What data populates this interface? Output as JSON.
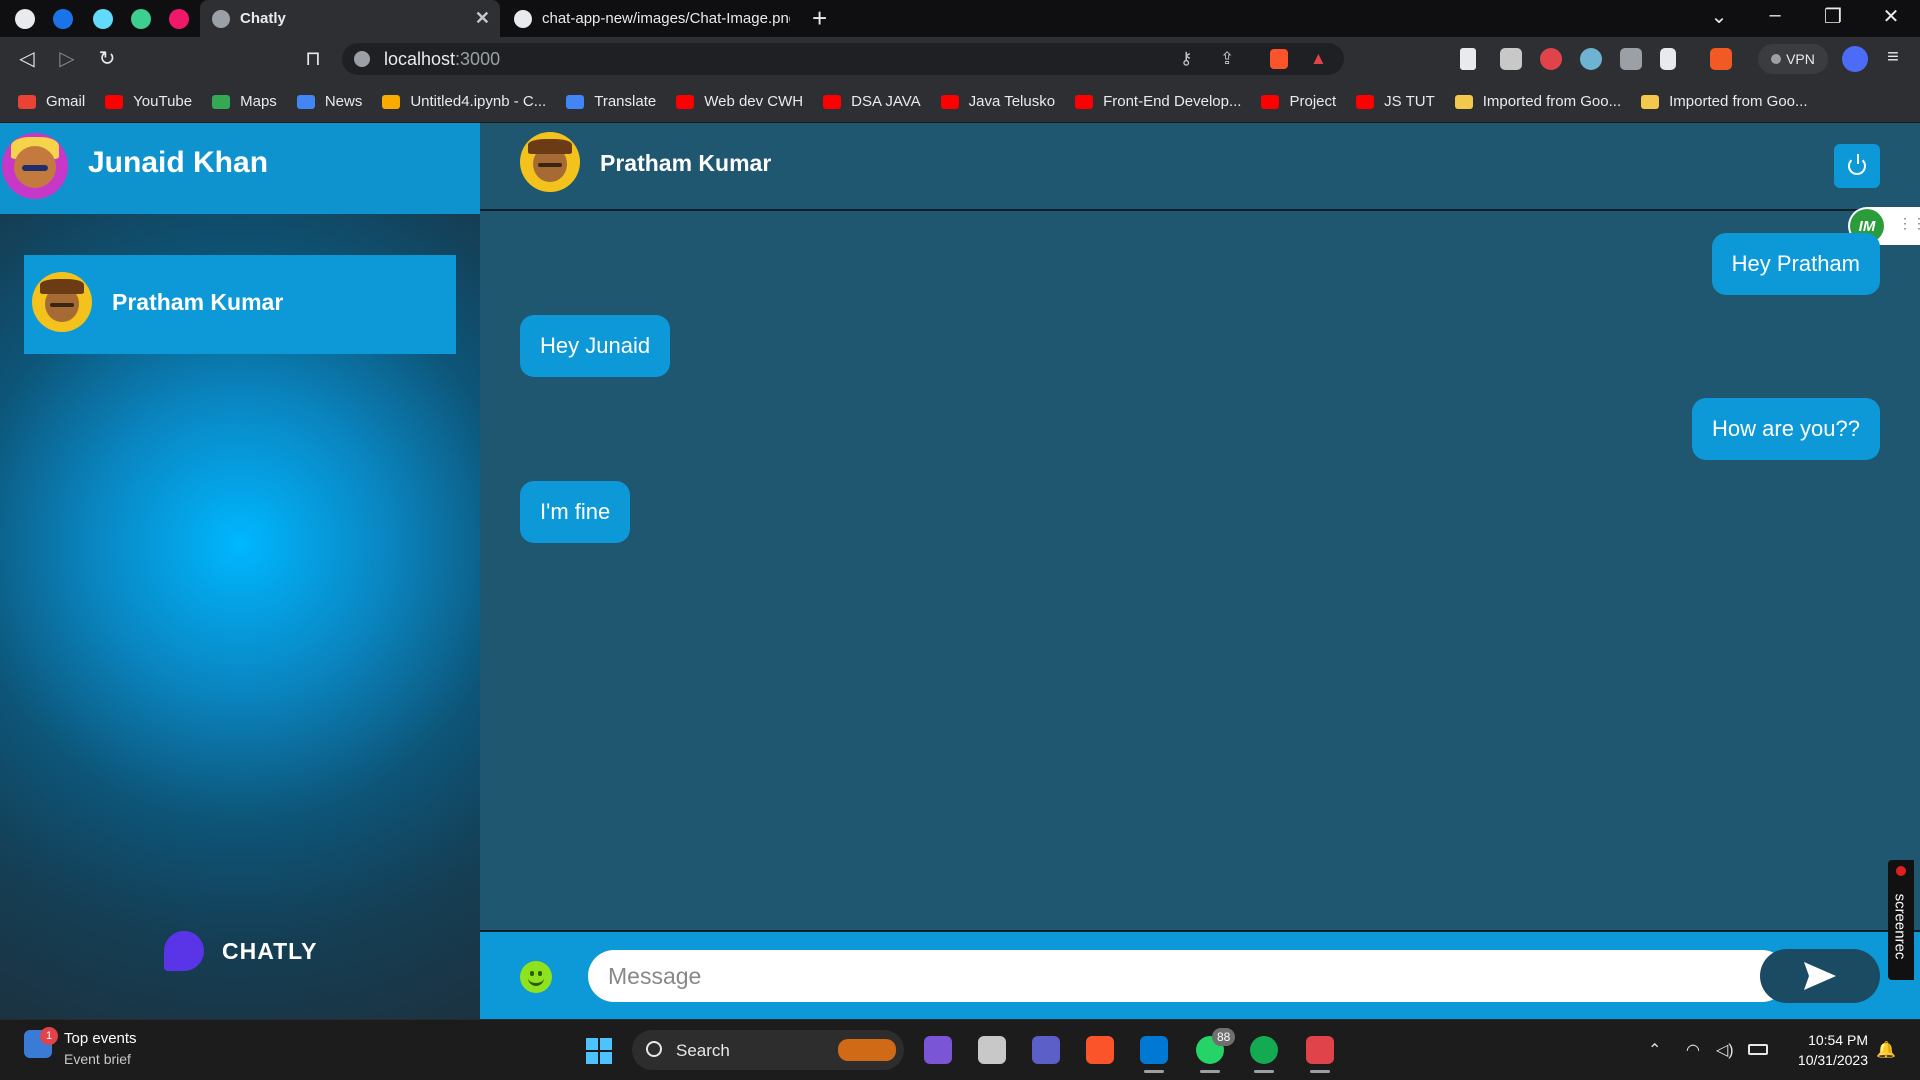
{
  "browser": {
    "tabs": [
      {
        "title": "Chatly",
        "active": true
      },
      {
        "title": "chat-app-new/images/Chat-Image.png",
        "active": false
      }
    ],
    "address": {
      "host": "localhost",
      "port": ":3000"
    },
    "vpn_label": "VPN"
  },
  "bookmarks": [
    {
      "label": "Gmail",
      "icon": "gmail-icon"
    },
    {
      "label": "YouTube",
      "icon": "youtube-icon"
    },
    {
      "label": "Maps",
      "icon": "maps-icon"
    },
    {
      "label": "News",
      "icon": "news-icon"
    },
    {
      "label": "Untitled4.ipynb - C...",
      "icon": "colab-icon"
    },
    {
      "label": "Translate",
      "icon": "translate-icon"
    },
    {
      "label": "Web dev CWH",
      "icon": "youtube-icon"
    },
    {
      "label": "DSA JAVA",
      "icon": "youtube-icon"
    },
    {
      "label": "Java Telusko",
      "icon": "youtube-icon"
    },
    {
      "label": "Front-End Develop...",
      "icon": "youtube-icon"
    },
    {
      "label": "Project",
      "icon": "youtube-icon"
    },
    {
      "label": "JS TUT",
      "icon": "youtube-icon"
    },
    {
      "label": "Imported from Goo...",
      "icon": "folder-icon"
    },
    {
      "label": "Imported from Goo...",
      "icon": "folder-icon"
    }
  ],
  "sidebar": {
    "user_name": "Junaid Khan",
    "contacts": [
      {
        "name": "Pratham Kumar"
      }
    ],
    "brand": "CHATLY"
  },
  "chat": {
    "contact_name": "Pratham Kumar",
    "messages": [
      {
        "text": "Hey Pratham",
        "side": "right"
      },
      {
        "text": "Hey Junaid",
        "side": "left"
      },
      {
        "text": "How are you??",
        "side": "right"
      },
      {
        "text": "I'm fine",
        "side": "left"
      }
    ],
    "composer": {
      "placeholder": "Message"
    }
  },
  "overlays": {
    "im_badge": "IM",
    "screenrec": "screenrec"
  },
  "colors": {
    "accent": "#0d98d8",
    "chat_bg": "#1f5670",
    "brand_purple": "#5a35e8"
  },
  "taskbar": {
    "widget_title": "Top events",
    "widget_subtitle": "Event brief",
    "widget_badge": "1",
    "search_label": "Search",
    "whatsapp_badge": "88",
    "time": "10:54 PM",
    "date": "10/31/2023"
  }
}
